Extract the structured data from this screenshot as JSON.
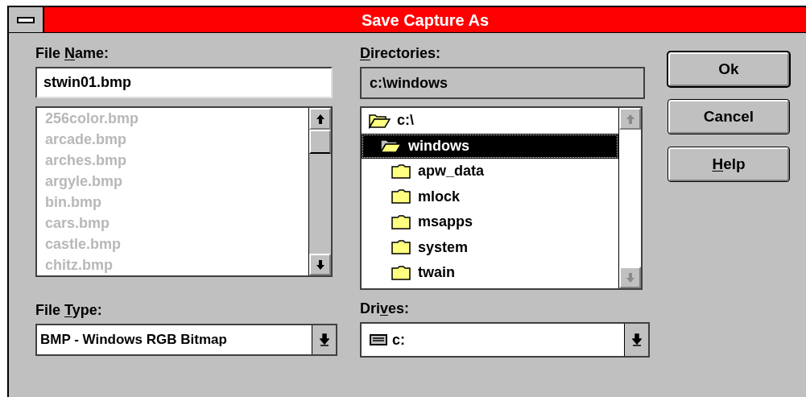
{
  "window": {
    "title": "Save Capture As"
  },
  "file_name": {
    "label": {
      "before": "File ",
      "key": "N",
      "after": "ame:"
    },
    "value": "stwin01.bmp",
    "files": [
      {
        "name": "256color.bmp",
        "disabled": true
      },
      {
        "name": "arcade.bmp",
        "disabled": true
      },
      {
        "name": "arches.bmp",
        "disabled": true
      },
      {
        "name": "argyle.bmp",
        "disabled": true
      },
      {
        "name": "bin.bmp",
        "disabled": true
      },
      {
        "name": "cars.bmp",
        "disabled": true
      },
      {
        "name": "castle.bmp",
        "disabled": true
      },
      {
        "name": "chitz.bmp",
        "disabled": true
      }
    ],
    "scrollbar_enabled": true
  },
  "directories": {
    "label": {
      "key": "D",
      "after": "irectories:"
    },
    "path": "c:\\windows",
    "tree": [
      {
        "name": "c:\\",
        "kind": "open",
        "selected": false,
        "children": [
          {
            "name": "windows",
            "kind": "open",
            "selected": true,
            "children": [
              {
                "name": "apw_data",
                "kind": "closed",
                "selected": false
              },
              {
                "name": "mlock",
                "kind": "closed",
                "selected": false
              },
              {
                "name": "msapps",
                "kind": "closed",
                "selected": false
              },
              {
                "name": "system",
                "kind": "closed",
                "selected": false
              },
              {
                "name": "twain",
                "kind": "closed",
                "selected": false
              }
            ]
          }
        ]
      }
    ],
    "scrollbar_enabled": false
  },
  "file_type": {
    "label": {
      "before": "File ",
      "key": "T",
      "after": "ype:"
    },
    "value": "BMP - Windows RGB Bitmap"
  },
  "drives": {
    "label": {
      "before": "Dri",
      "key": "v",
      "after": "es:"
    },
    "value": "c:"
  },
  "buttons": [
    {
      "label": {
        "after": "Ok"
      },
      "default": true
    },
    {
      "label": {
        "after": "Cancel"
      },
      "default": false
    },
    {
      "label": {
        "key": "H",
        "after": "elp"
      },
      "default": false
    }
  ]
}
